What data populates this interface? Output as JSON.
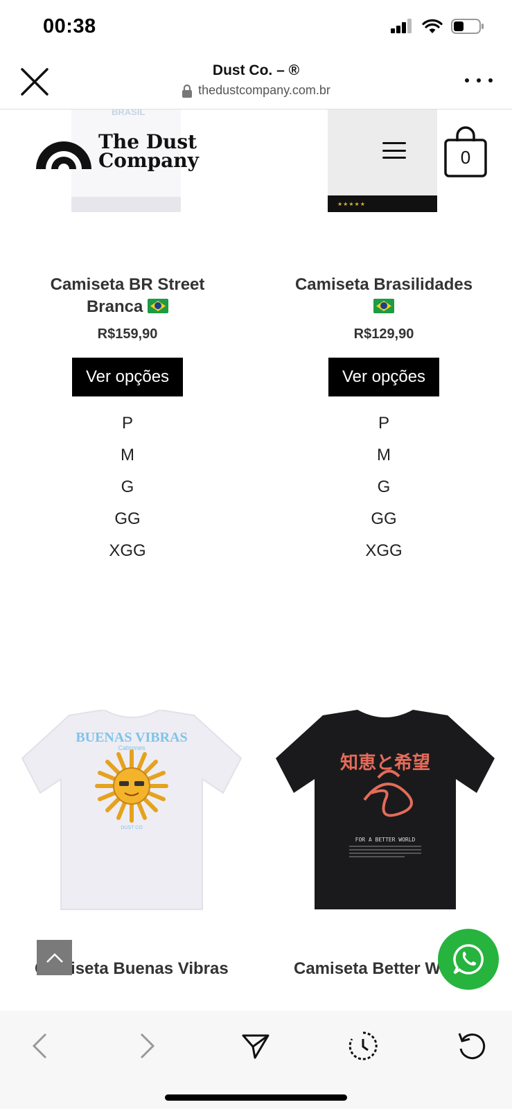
{
  "status_bar": {
    "time": "00:38",
    "icons": [
      "cellular-signal-icon",
      "wifi-icon",
      "battery-icon"
    ]
  },
  "browser": {
    "title": "Dust Co. – ®",
    "url": "thedustcompany.com.br",
    "icons": [
      "close-icon",
      "lock-icon",
      "more-icon"
    ]
  },
  "site_header": {
    "brand_line1": "The Dust",
    "brand_line2": "Company",
    "cart_count": "0",
    "thumb_text": "BRASIL",
    "thumb_dots": "★★★★★"
  },
  "products": [
    {
      "name": "Camiseta BR Street Branca",
      "flag": "brazil-flag-icon",
      "price": "R$159,90",
      "button": "Ver opções",
      "sizes": [
        "P",
        "M",
        "G",
        "GG",
        "XGG"
      ]
    },
    {
      "name": "Camiseta Brasilidades",
      "flag": "brazil-flag-icon",
      "price": "R$129,90",
      "button": "Ver opções",
      "sizes": [
        "P",
        "M",
        "G",
        "GG",
        "XGG"
      ]
    }
  ],
  "next_products": [
    {
      "name": "Camiseta Buenas Vibras",
      "print_title": "BUENAS VIBRAS",
      "print_sub": "Cabrones",
      "print_small": "DUST CO"
    },
    {
      "name": "Camiseta Better World",
      "print_title": "知恵と希望",
      "print_sub": "FOR A BETTER WORLD"
    }
  ],
  "colors": {
    "accent_black": "#000000",
    "whatsapp_green": "#26b43e",
    "back_to_top_gray": "#7a7a7a"
  },
  "bottom_bar_icons": [
    "back-arrow-icon",
    "forward-arrow-icon",
    "share-icon",
    "history-icon",
    "reload-icon"
  ]
}
